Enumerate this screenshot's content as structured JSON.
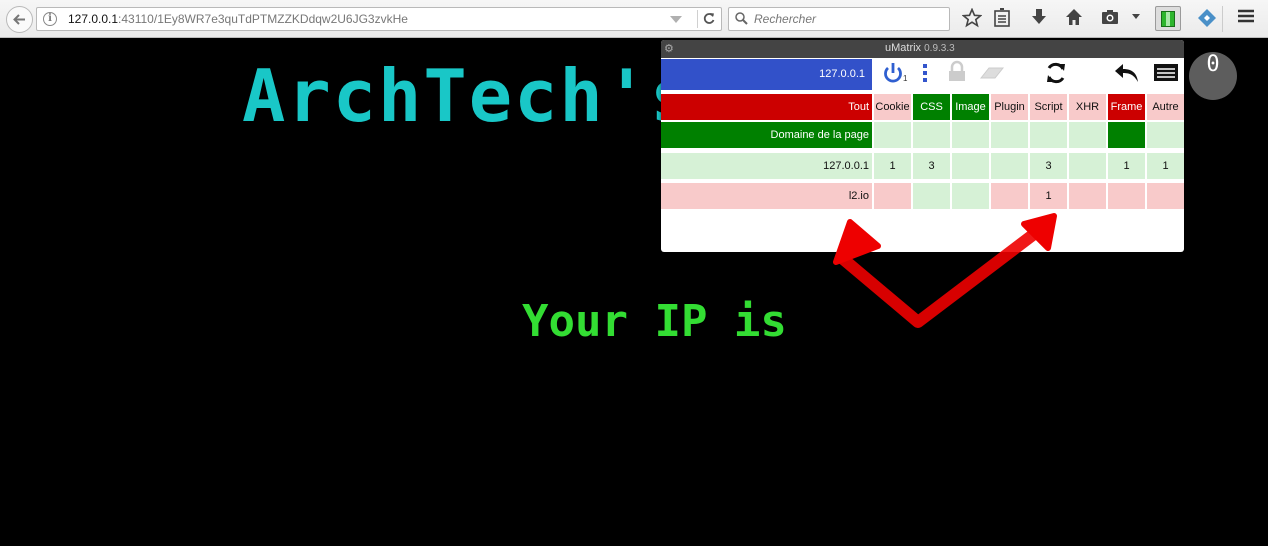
{
  "browser": {
    "url_host": "127.0.0.1",
    "url_rest": ":43110/1Ey8WR7e3quTdPTMZZKDdqw2U6JG3zvkHe",
    "search_placeholder": "Rechercher"
  },
  "page": {
    "title": "ArchTech's",
    "ip_text": "Your IP is",
    "counter": "0"
  },
  "umatrix": {
    "title": "uMatrix",
    "version": "0.9.3.3",
    "scope": "127.0.0.1",
    "power_badge": "1",
    "columns": [
      "Tout",
      "Cookie",
      "CSS",
      "Image",
      "Plugin",
      "Script",
      "XHR",
      "Frame",
      "Autre"
    ],
    "rows": [
      {
        "label": "Domaine de la page",
        "cells": [
          "",
          "",
          "",
          "",
          "",
          "",
          "",
          ""
        ]
      },
      {
        "label": "127.0.0.1",
        "cells": [
          "1",
          "3",
          "",
          "",
          "3",
          "",
          "1",
          "1"
        ]
      },
      {
        "label": "l2.io",
        "cells": [
          "",
          "",
          "",
          "",
          "1",
          "",
          "",
          ""
        ]
      }
    ]
  },
  "colors": {
    "title_color": "#19c7c7",
    "ip_color": "#33dd33",
    "block_red": "#cc0000",
    "allow_green": "#008000",
    "scope_blue": "#3251c9"
  }
}
